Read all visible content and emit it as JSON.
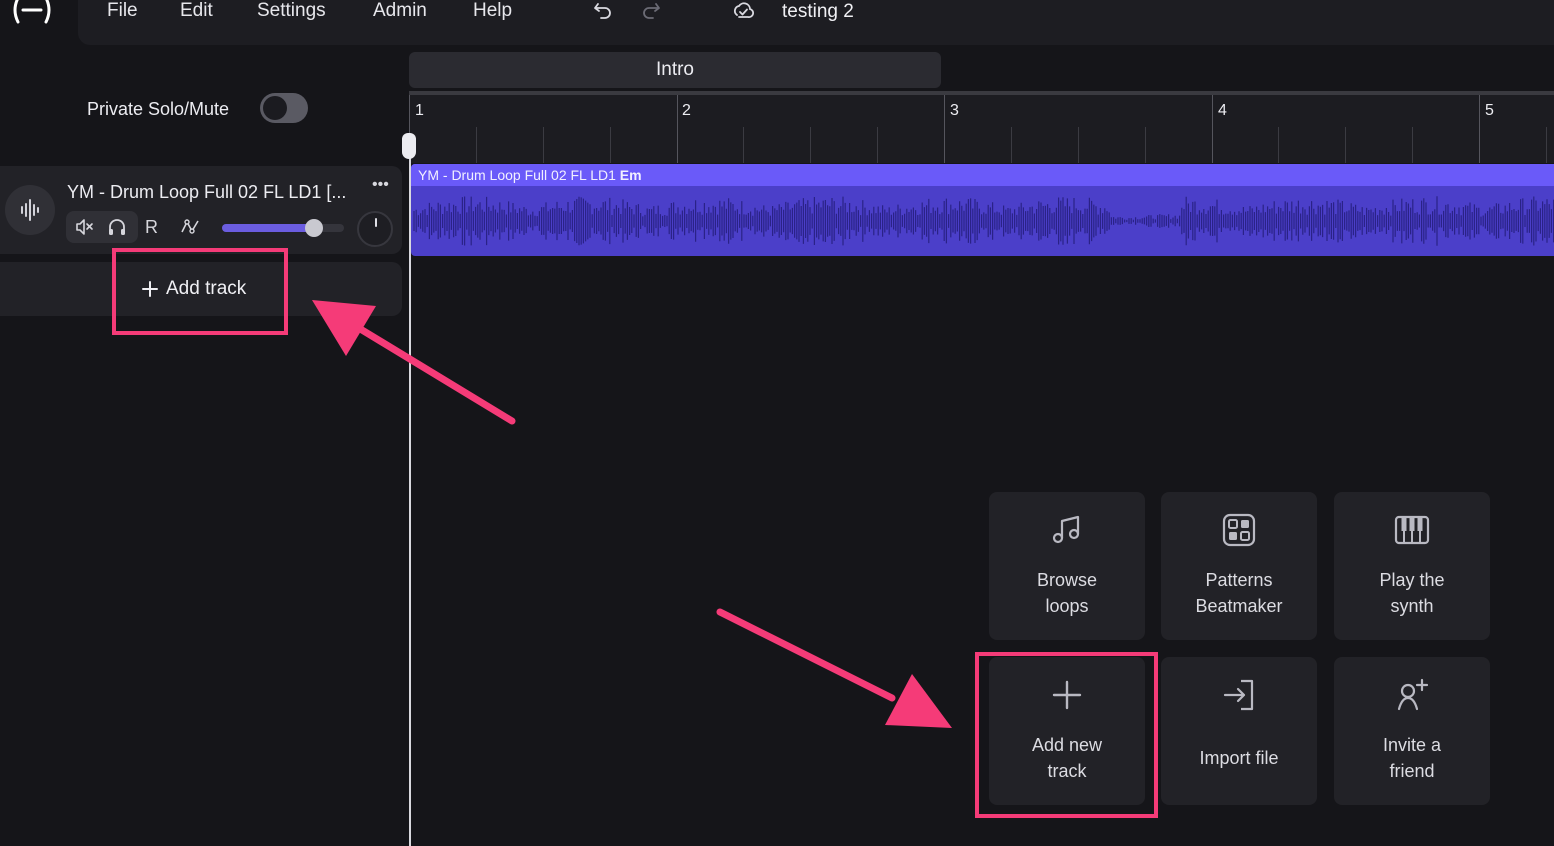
{
  "app": {
    "logo_icon": "bandlab-logo-icon",
    "project_title": "testing 2"
  },
  "menu": {
    "items": [
      "File",
      "Edit",
      "Settings",
      "Admin",
      "Help"
    ],
    "undo_icon": "undo-icon",
    "redo_icon": "redo-icon",
    "sync_icon": "cloud-sync-icon"
  },
  "left_panel": {
    "private_solo_mute_label": "Private Solo/Mute",
    "private_solo_mute_on": false,
    "track": {
      "name": "YM - Drum Loop Full 02 FL LD1 [...",
      "avatar_icon": "waveform-icon",
      "menu_label": "•••",
      "mute_icon": "mute-icon",
      "solo_icon": "headphones-icon",
      "record_label": "R",
      "automation_icon": "automation-icon",
      "volume_level": 0.75,
      "pan_icon": "pan-knob"
    },
    "add_track_label": "Add track"
  },
  "timeline": {
    "section_label": "Intro",
    "bar_numbers": [
      "1",
      "2",
      "3",
      "4",
      "5"
    ],
    "clip": {
      "name": "YM - Drum Loop Full 02 FL LD1",
      "key": "Em"
    }
  },
  "action_tiles": [
    {
      "label": "Browse\nloops",
      "icon": "music-note-icon"
    },
    {
      "label": "Patterns\nBeatmaker",
      "icon": "patterns-grid-icon"
    },
    {
      "label": "Play the\nsynth",
      "icon": "piano-keys-icon"
    },
    {
      "label": "Add new\ntrack",
      "icon": "plus-icon"
    },
    {
      "label": "Import file",
      "icon": "import-icon"
    },
    {
      "label": "Invite a\nfriend",
      "icon": "invite-user-icon"
    }
  ],
  "annotation": {
    "color": "#f53b78"
  },
  "colors": {
    "background": "#151519",
    "clip": "#4b3fc9",
    "clip_header": "#6a5af9",
    "accent": "#6b5de0"
  }
}
